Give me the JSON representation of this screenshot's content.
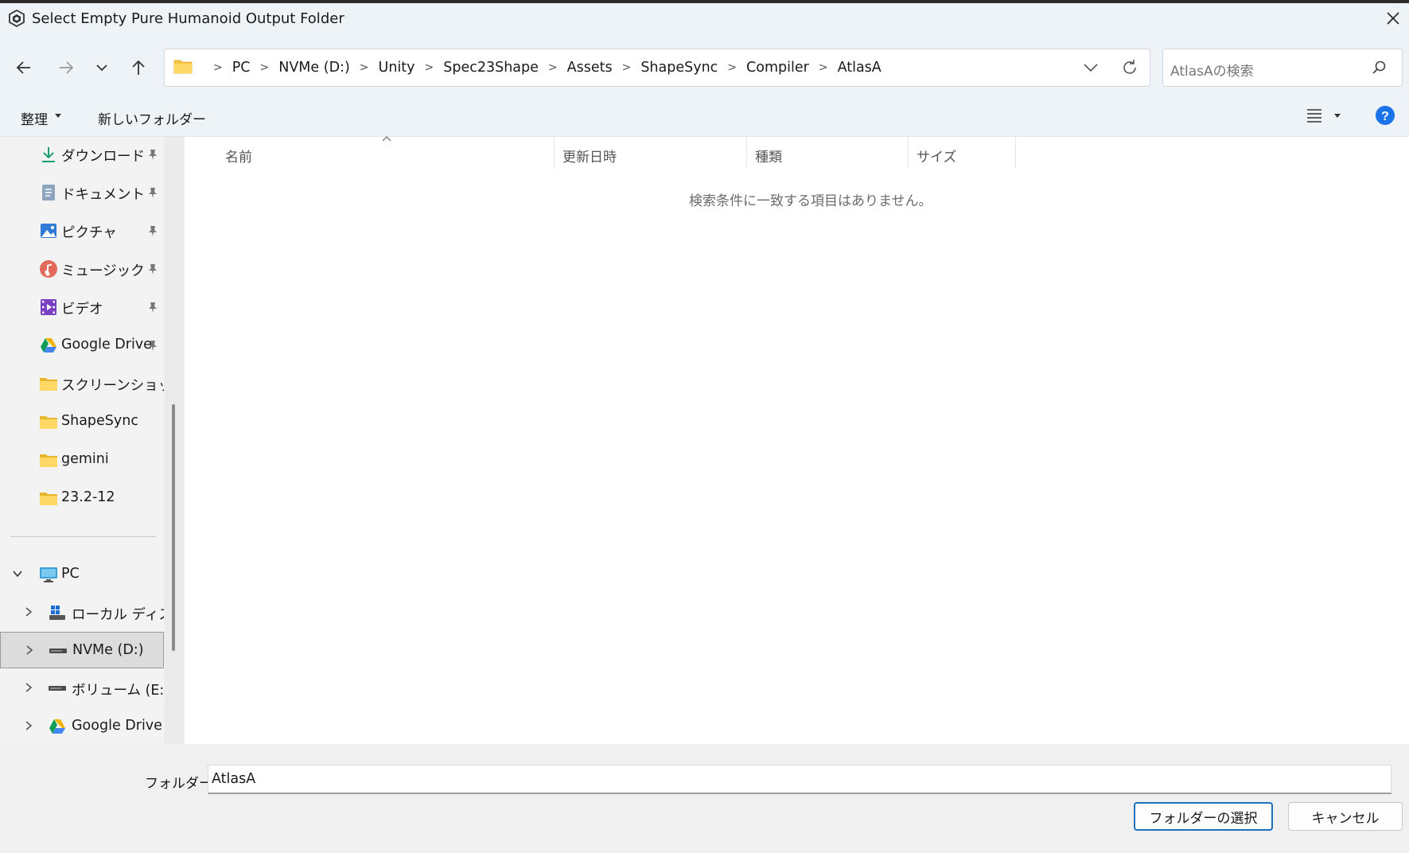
{
  "window": {
    "title": "Select Empty Pure Humanoid Output Folder"
  },
  "address": {
    "crumbs": [
      "PC",
      "NVMe (D:)",
      "Unity",
      "Spec23Shape",
      "Assets",
      "ShapeSync",
      "Compiler",
      "AtlasA"
    ]
  },
  "search": {
    "placeholder": "AtlasAの検索"
  },
  "commandbar": {
    "organize_label": "整理",
    "new_folder_label": "新しいフォルダー"
  },
  "sidebar": {
    "quick_access": [
      {
        "label": "ダウンロード",
        "icon": "download-icon",
        "pinned": true
      },
      {
        "label": "ドキュメント",
        "icon": "documents-icon",
        "pinned": true
      },
      {
        "label": "ピクチャ",
        "icon": "pictures-icon",
        "pinned": true
      },
      {
        "label": "ミュージック",
        "icon": "music-icon",
        "pinned": true
      },
      {
        "label": "ビデオ",
        "icon": "videos-icon",
        "pinned": true
      },
      {
        "label": "Google Drive",
        "icon": "google-drive-icon",
        "pinned": true
      },
      {
        "label": "スクリーンショット",
        "icon": "folder-icon",
        "pinned": false
      },
      {
        "label": "ShapeSync",
        "icon": "folder-icon",
        "pinned": false
      },
      {
        "label": "gemini",
        "icon": "folder-icon",
        "pinned": false
      },
      {
        "label": "23.2-12",
        "icon": "folder-icon",
        "pinned": false
      }
    ],
    "tree": [
      {
        "label": "PC",
        "icon": "pc-icon",
        "expanded": true
      },
      {
        "label": "ローカル ディスク",
        "icon": "local-disk-icon",
        "expanded": false
      },
      {
        "label": "NVMe (D:)",
        "icon": "drive-icon",
        "expanded": false,
        "selected": true
      },
      {
        "label": "ボリューム (E:)",
        "icon": "drive-icon",
        "expanded": false
      },
      {
        "label": "Google Drive (",
        "icon": "google-drive-icon",
        "expanded": false
      }
    ]
  },
  "filelist": {
    "columns": [
      "名前",
      "更新日時",
      "種類",
      "サイズ"
    ],
    "empty_message": "検索条件に一致する項目はありません。"
  },
  "footer": {
    "folder_label": "フォルダー:",
    "folder_value": "AtlasA",
    "select_button": "フォルダーの選択",
    "cancel_button": "キャンセル"
  },
  "colors": {
    "chrome_bg": "#eef3f8",
    "accent": "#1f6fbf",
    "folder_yellow": "#f4c542",
    "help_blue": "#1a73e8"
  }
}
